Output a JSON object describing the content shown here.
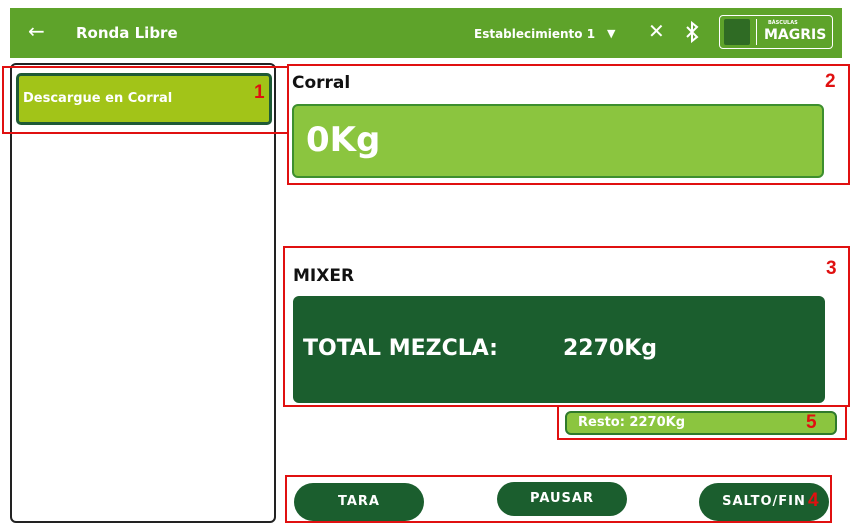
{
  "header": {
    "back_icon": "arrow-left-icon",
    "title": "Ronda Libre",
    "establishment": "Establecimiento 1",
    "dropdown_icon": "caret-down-icon",
    "close_icon": "close-icon",
    "bluetooth_icon": "bluetooth-icon",
    "logo": {
      "small_text": "BÁSCULAS",
      "brand": "MAGRIS"
    },
    "background_color": "#5ea32a"
  },
  "sidebar": {
    "items": [
      {
        "label": "Descargue en Corral"
      }
    ]
  },
  "corral": {
    "label": "Corral",
    "value": "0Kg"
  },
  "mixer": {
    "label": "MIXER",
    "total_label": "TOTAL MEZCLA:",
    "total_value": "2270Kg"
  },
  "resto": {
    "text": "Resto: 2270Kg"
  },
  "buttons": {
    "tara": "TARA",
    "pausar": "PAUSAR",
    "salto": "SALTO/FIN"
  },
  "annotations": [
    "1",
    "2",
    "3",
    "4",
    "5"
  ],
  "colors": {
    "dark_green": "#1b5e2e",
    "light_green": "#8bc53f",
    "item_green": "#a2c418",
    "annotation_red": "#e01010"
  }
}
